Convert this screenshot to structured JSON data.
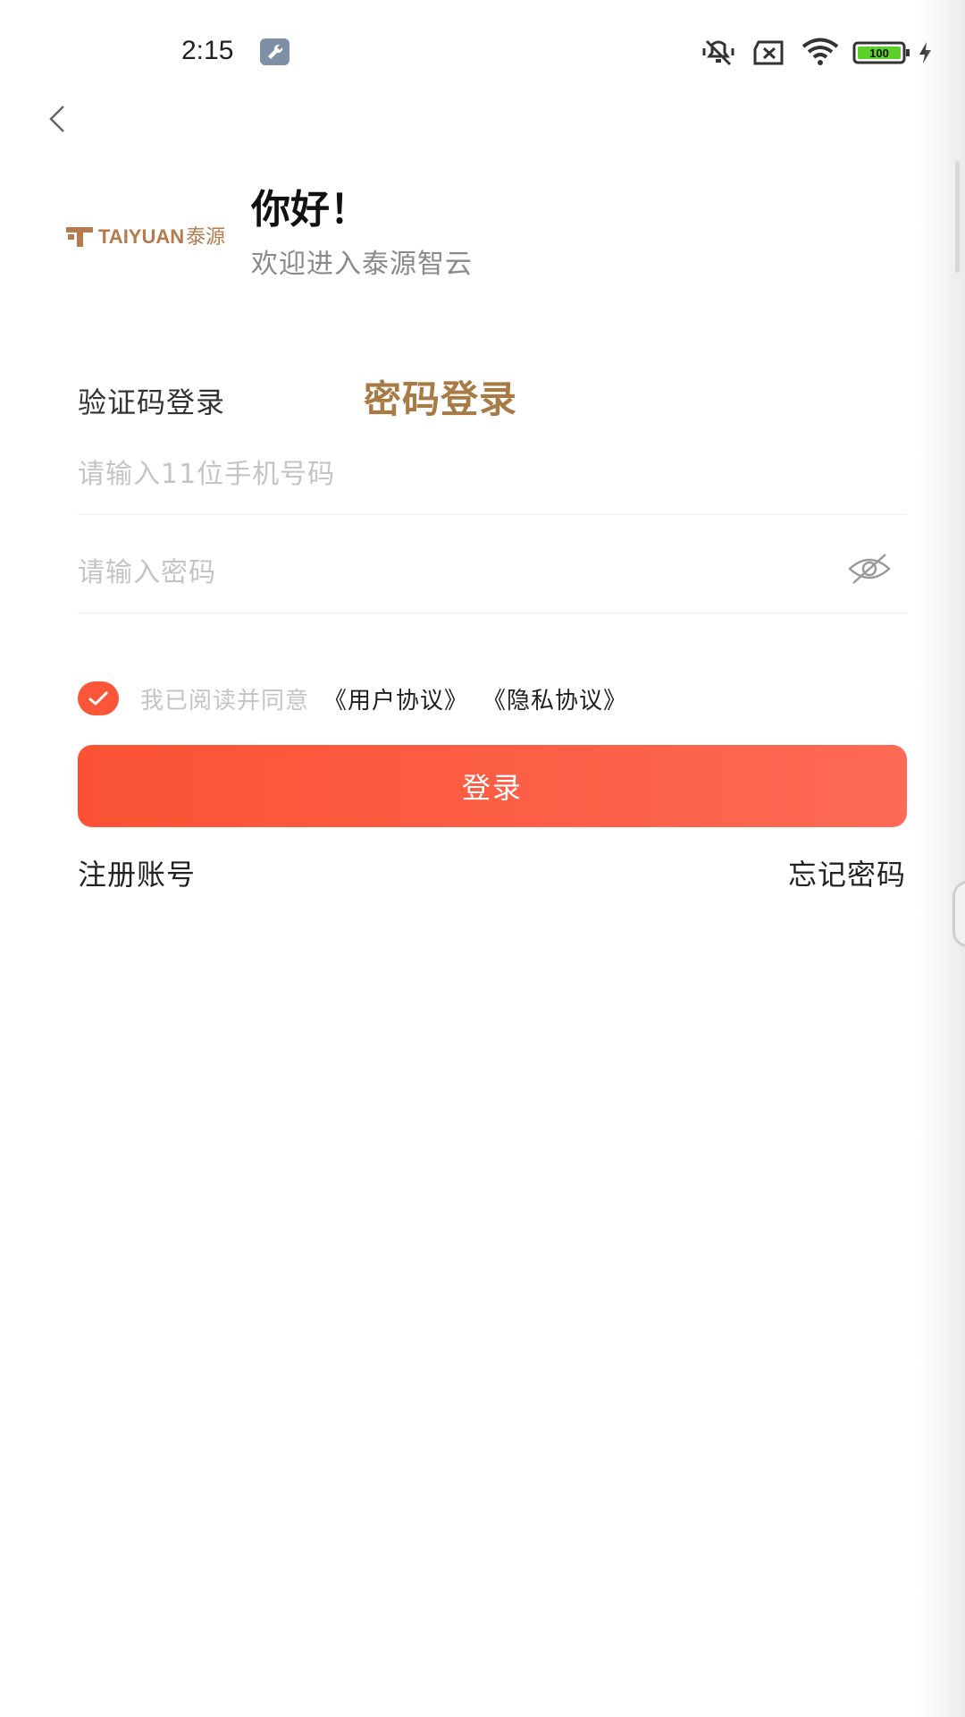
{
  "status_bar": {
    "time": "2:15",
    "battery": "100",
    "icons": [
      "wrench-icon",
      "mute-icon",
      "no-sim-icon",
      "wifi-icon",
      "battery-icon",
      "charging-icon"
    ]
  },
  "header": {
    "brand_latin": "TAIYUAN",
    "brand_cn": "泰源",
    "title": "你好！",
    "subtitle": "欢迎进入泰源智云"
  },
  "tabs": {
    "sms_label": "验证码登录",
    "password_label": "密码登录",
    "active": "password"
  },
  "form": {
    "phone_placeholder": "请输入11位手机号码",
    "phone_value": "",
    "password_placeholder": "请输入密码",
    "password_value": ""
  },
  "agreement": {
    "checked": true,
    "text": "我已阅读并同意",
    "user_agreement": "《用户协议》",
    "privacy_agreement": "《隐私协议》"
  },
  "actions": {
    "login_label": "登录",
    "register_label": "注册账号",
    "forgot_label": "忘记密码"
  },
  "colors": {
    "accent": "#fb563a",
    "brand_gold": "#a87b45",
    "placeholder": "#c4c4c4"
  }
}
